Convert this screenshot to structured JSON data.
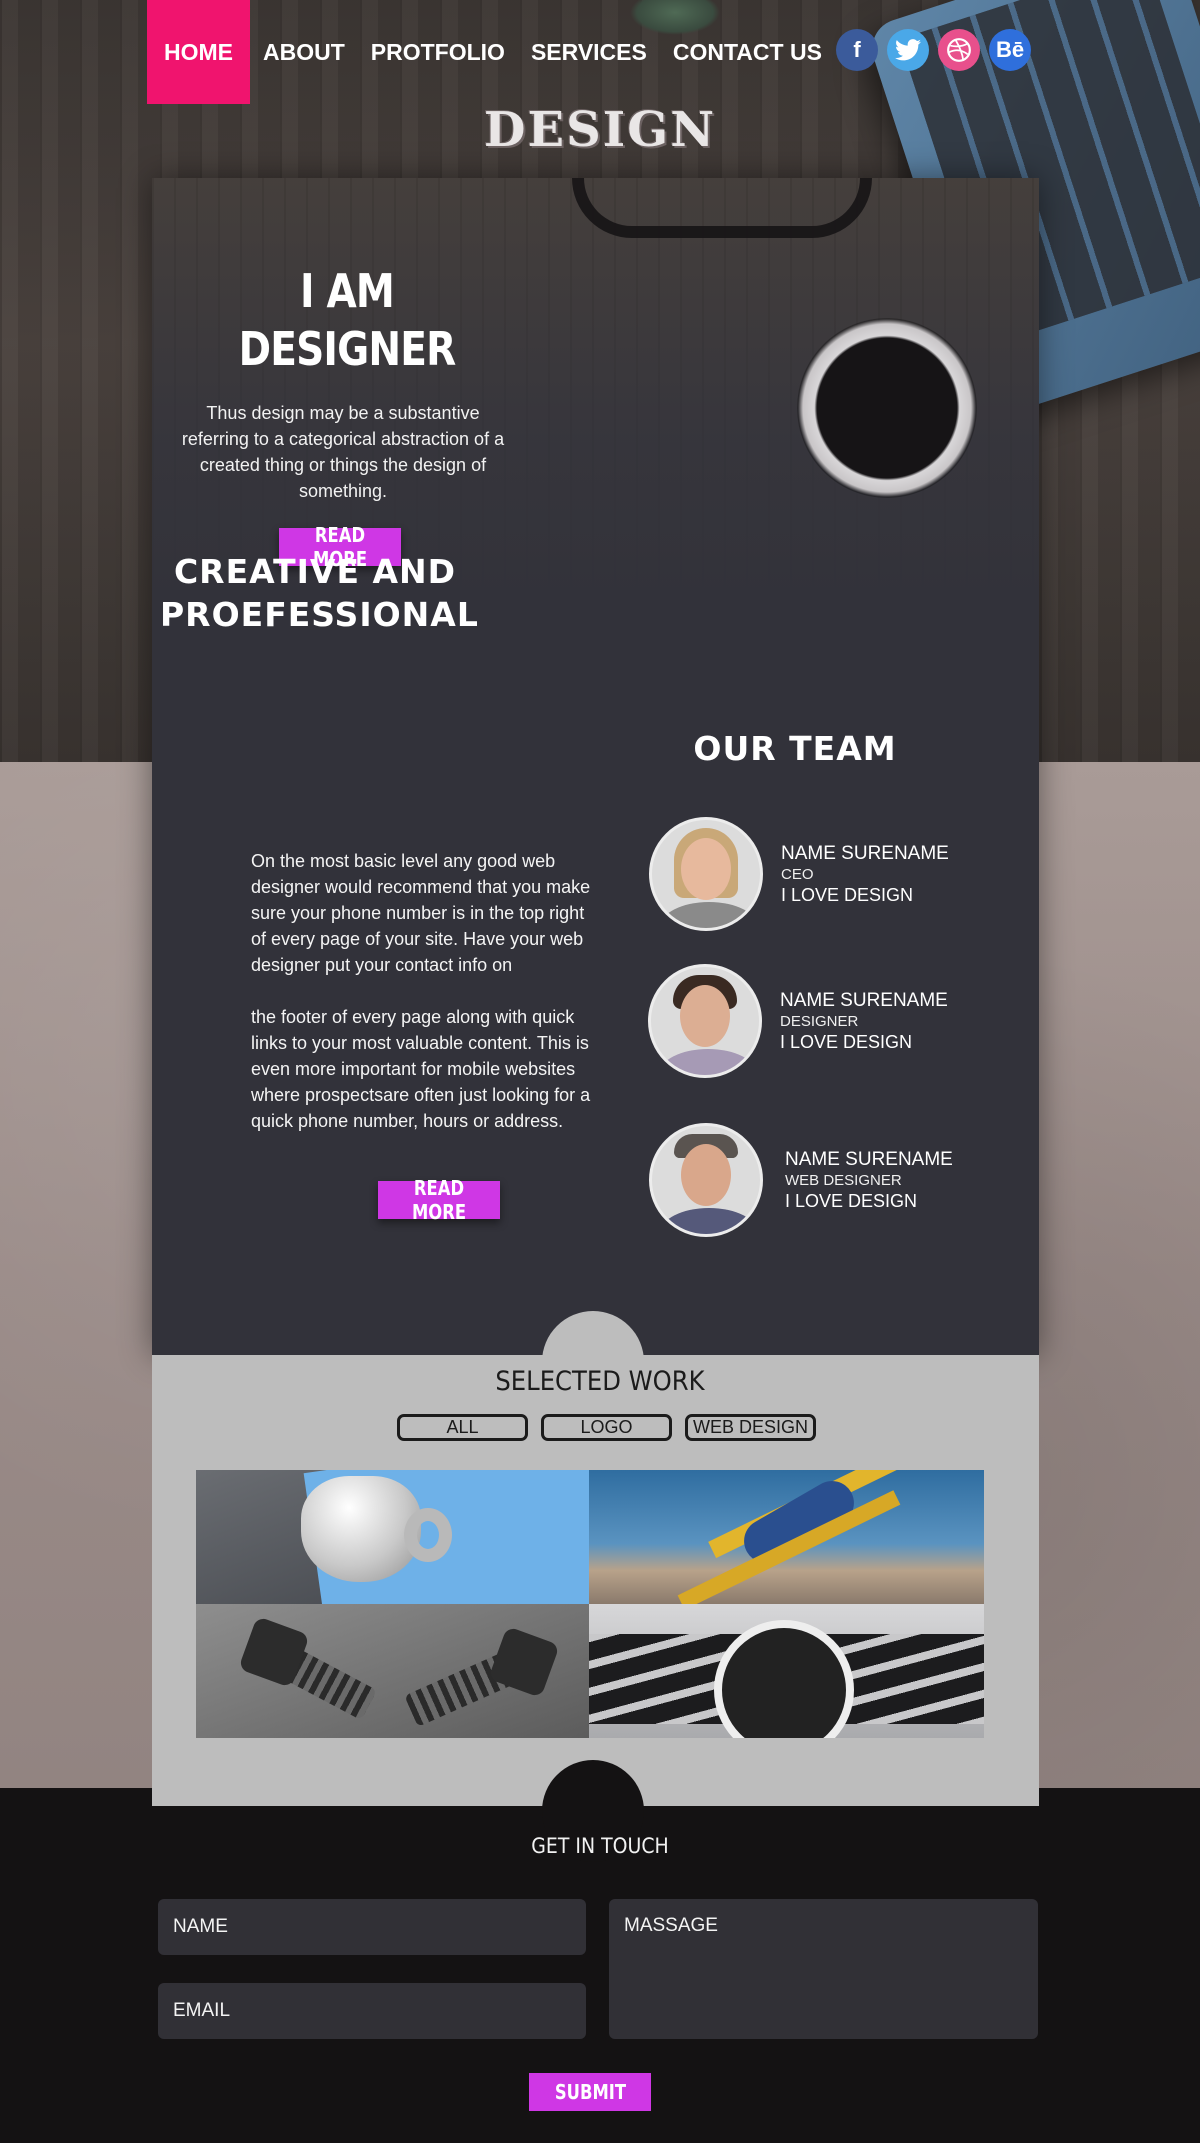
{
  "nav": {
    "items": [
      {
        "label": "HOME",
        "active": true
      },
      {
        "label": "ABOUT",
        "active": false
      },
      {
        "label": "PROTFOLIO",
        "active": false
      },
      {
        "label": "SERVICES",
        "active": false
      },
      {
        "label": "CONTACT US",
        "active": false
      }
    ],
    "accent_color": "#f0146e"
  },
  "socials": [
    {
      "icon": "facebook-icon",
      "glyph": "f",
      "color": "#3b5b9b"
    },
    {
      "icon": "twitter-icon",
      "glyph": "t",
      "color": "#4aa8e8"
    },
    {
      "icon": "dribbble-icon",
      "glyph": "◎",
      "color": "#e8508c"
    },
    {
      "icon": "behance-icon",
      "glyph": "Bē",
      "color": "#2f6fdc"
    }
  ],
  "brand": {
    "logo": "DESIGN"
  },
  "hero": {
    "title_line1": "I AM",
    "title_line2": "DESIGNER",
    "text": "Thus design may be a substantive referring to a categorical abstraction of a created thing or things the design of something.",
    "button": "READ MORE"
  },
  "creative": {
    "title_line1": "CREATIVE AND",
    "title_line2": "PROEFESSIONAL",
    "paragraph1": "On the most basic level  any good web designer would recommend that you make sure your phone number is in the top right of every page of your site. Have your web designer put your contact info on",
    "paragraph2": "the footer of every page along with quick links to your most valuable content. This is even more important for mobile websites where prospectsare often just looking for a quick phone number, hours or address.",
    "button": "READ MORE"
  },
  "team": {
    "title": "OUR TEAM",
    "members": [
      {
        "name": "NAME SURENAME",
        "role": "CEO",
        "motto": "I LOVE DESIGN"
      },
      {
        "name": "NAME SURENAME",
        "role": "DESIGNER",
        "motto": "I LOVE DESIGN"
      },
      {
        "name": "NAME SURENAME",
        "role": "WEB DESIGNER",
        "motto": "I LOVE DESIGN"
      }
    ]
  },
  "work": {
    "title": "SELECTED WORK",
    "filters": [
      "ALL",
      "LOGO",
      "WEB DESIGN"
    ]
  },
  "contact": {
    "title": "GET IN TOUCH",
    "name_placeholder": "NAME",
    "email_placeholder": "EMAIL",
    "message_placeholder": "MASSAGE",
    "submit": "SUBMIT"
  },
  "colors": {
    "button": "#cf37e5",
    "panel": "#32323a",
    "work_bg": "#bdbdbd",
    "footer_bg": "#141213"
  }
}
